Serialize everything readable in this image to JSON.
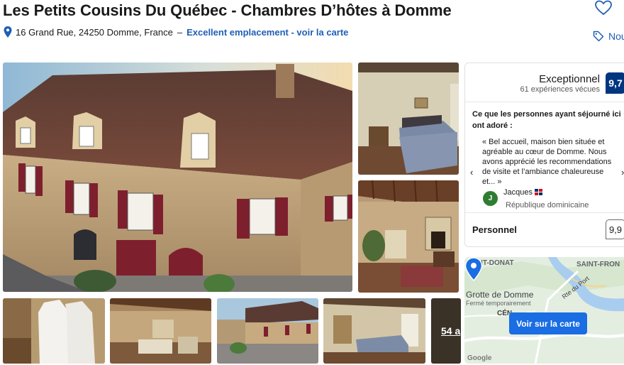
{
  "header": {
    "title": "Les Petits Cousins Du Québec - Chambres D’hôtes à Domme",
    "address": "16 Grand Rue, 24250 Domme, France",
    "separator": "–",
    "location_link": "Excellent emplacement - voir la carte",
    "tag_button_label": "Nou"
  },
  "gallery": {
    "more_photos_label": "54 a"
  },
  "review_panel": {
    "rating_word": "Exceptionnel",
    "review_count": "61 expériences vécues",
    "score": "9,7",
    "loved_heading": "Ce que les personnes ayant séjourné ici ont adoré :",
    "quote": "« Bel accueil, maison bien située et agréable au cœur de Domme. Nous avons apprécié les recommendations de visite et l’ambiance chaleureuse et... »",
    "prev_arrow": "‹",
    "next_arrow": "›",
    "reviewer": {
      "initial": "J",
      "name": "Jacques",
      "country": "République dominicaine"
    },
    "category": {
      "label": "Personnel",
      "score": "9,9"
    }
  },
  "map": {
    "place_1": "SAINT-DONAT",
    "place_2": "SAINT-FRON",
    "poi_name": "Grotte de Domme",
    "poi_status": "Fermé temporairement",
    "partial_label": "CÉN",
    "road_label": "Rte du Port",
    "provider": "Google",
    "button_label": "Voir sur la carte"
  },
  "colors": {
    "brand_blue": "#003580",
    "link_blue": "#1f5fb4",
    "map_button": "#1a6de3"
  }
}
